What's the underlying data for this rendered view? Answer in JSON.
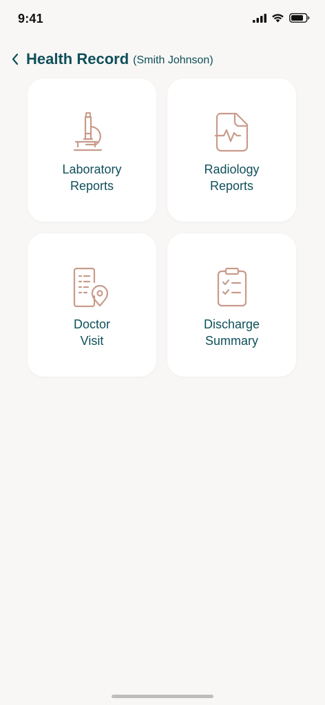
{
  "status_bar": {
    "time": "9:41"
  },
  "header": {
    "title": "Health Record",
    "subtitle": "(Smith Johnson)"
  },
  "cards": [
    {
      "line1": "Laboratory",
      "line2": "Reports",
      "icon": "microscope-icon"
    },
    {
      "line1": "Radiology",
      "line2": "Reports",
      "icon": "radiology-report-icon"
    },
    {
      "line1": "Doctor",
      "line2": "Visit",
      "icon": "doctor-visit-icon"
    },
    {
      "line1": "Discharge",
      "line2": "Summary",
      "icon": "clipboard-check-icon"
    }
  ],
  "colors": {
    "accent": "#0f4f5a",
    "icon": "#c99a8a",
    "background": "#f8f7f5",
    "card": "#ffffff"
  }
}
